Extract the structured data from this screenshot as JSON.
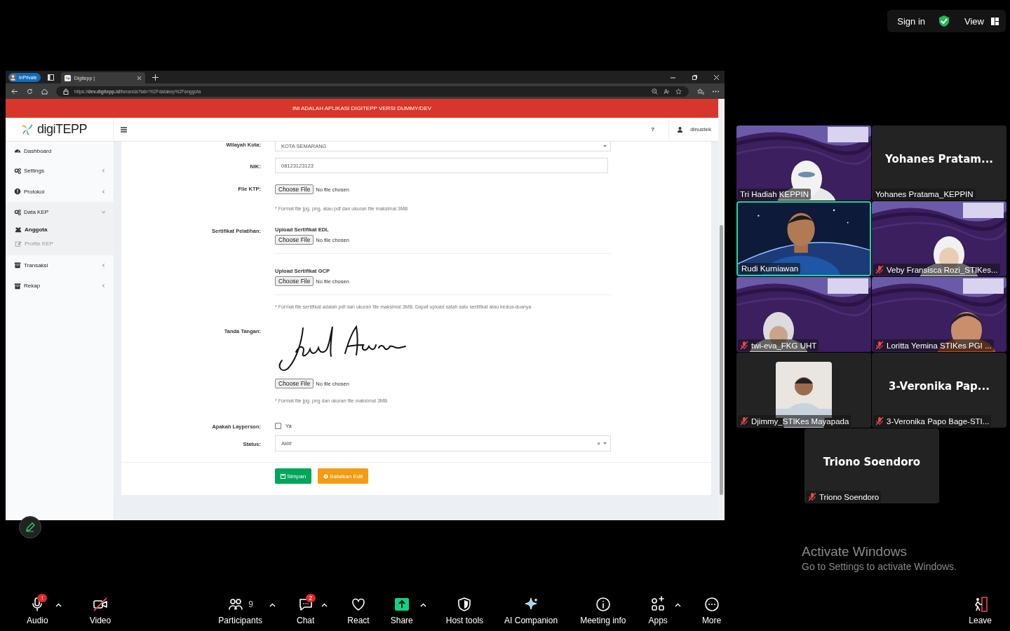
{
  "top_bar": {
    "sign_in": "Sign in",
    "view": "View"
  },
  "browser": {
    "inprivate": "InPrivate",
    "tab": {
      "title": "Digitepp |",
      "selected": true
    },
    "url": "https://**dev.digitepp.id**/beranda?tab=%2Fdatakep%2Fanggota"
  },
  "app": {
    "banner": "INI ADALAH APLIKASI DIGITEPP VERSI DUMMY/DEV",
    "logo": "digiTEPP",
    "help": "?",
    "user": "dinustek",
    "sidebar": [
      {
        "label": "Dashboard"
      },
      {
        "label": "Settings",
        "expanded": false
      },
      {
        "label": "Protokol",
        "expanded": false
      },
      {
        "label": "Data KEP",
        "expanded": true,
        "children": [
          {
            "label": "Anggota",
            "selected": true
          },
          {
            "label": "Profile KEP",
            "selected": false
          }
        ]
      },
      {
        "label": "Transaksi",
        "expanded": false
      },
      {
        "label": "Rekap",
        "expanded": false
      }
    ],
    "form": [
      {
        "kind": "select",
        "label": "Wilayah Kota:",
        "value": "KOTA SEMARANG"
      },
      {
        "kind": "text",
        "label": "NIK:",
        "value": "08123123123"
      },
      {
        "kind": "file",
        "label": "File KTP:",
        "button": "Choose File",
        "status": "No file chosen",
        "note": "* Format file jpg, png, atau pdf dan ukuran file maksimal 3MB"
      },
      {
        "kind": "uploads",
        "label": "Sertifikat Pelatihan:",
        "uploads": [
          {
            "title": "Upload Sertifikat EDL",
            "button": "Choose File",
            "status": "No file chosen"
          },
          {
            "title": "Upload Sertifikat GCP",
            "button": "Choose File",
            "status": "No file chosen"
          }
        ],
        "note": "* Format file sertifikat adalah pdf dan ukuran file maksimal 3MB. Dapat upload salah satu sertifikat atau kedua-duanya"
      },
      {
        "kind": "signature",
        "label": "Tanda Tangan:",
        "button": "Choose File",
        "status": "No file chosen",
        "note": "* Format file jpg, png dan ukuran file maksimal 3MB"
      },
      {
        "kind": "checkbox",
        "label": "Apakah Layperson:",
        "option": "Ya",
        "checked": false
      },
      {
        "kind": "select",
        "label": "Status:",
        "value": "Aktif",
        "clear": "×"
      }
    ],
    "buttons": [
      {
        "kind": "primary",
        "label": "Simpan"
      },
      {
        "kind": "warning",
        "label": "Batalkan Edit"
      }
    ]
  },
  "gallery": [
    {
      "kind": "video",
      "name": "Tri Hadiah KEPPIN",
      "muted": false,
      "speaking": false
    },
    {
      "kind": "name",
      "title": "Yohanes  Pratam...",
      "name": "Yohanes Pratama_KEPPIN",
      "muted": false,
      "speaking": false
    },
    {
      "kind": "video",
      "name": "Rudi Kurniawan",
      "muted": false,
      "speaking": true
    },
    {
      "kind": "video",
      "name": "Veby Fransisca Rozi_STIKes...",
      "muted": true,
      "speaking": false
    },
    {
      "kind": "video",
      "name": "twi-eva_FKG UHT",
      "muted": true,
      "speaking": false
    },
    {
      "kind": "video",
      "name": "Loritta Yemina STIKes PGI ...",
      "muted": true,
      "speaking": false
    },
    {
      "name": "Djimmy_STIKes Mayapada",
      "muted": true,
      "speaking": false
    },
    {
      "kind": "name",
      "title": "3-Veronika  Pap...",
      "name": "3-Veronika Papo Bage-STI...",
      "muted": true,
      "speaking": false
    },
    {
      "kind": "name",
      "title": "Triono Soendoro",
      "name": "Triono Soendoro",
      "muted": true,
      "speaking": false
    }
  ],
  "activation": {
    "title": "Activate Windows",
    "text": "Go to Settings to activate Windows."
  },
  "toolbar": [
    {
      "label": "Audio",
      "on": true,
      "badge": "!",
      "caret": true
    },
    {
      "label": "Video",
      "on": false
    },
    {
      "label": "Participants",
      "count": "9",
      "caret": true
    },
    {
      "label": "Chat",
      "badge": "2",
      "caret": true
    },
    {
      "label": "React"
    },
    {
      "label": "Share",
      "caret": true
    },
    {
      "label": "Host tools"
    },
    {
      "label": "AI Companion"
    },
    {
      "label": "Meeting info"
    },
    {
      "label": "Apps",
      "caret": true
    },
    {
      "label": "More"
    }
  ],
  "leave": {
    "label": "Leave"
  }
}
